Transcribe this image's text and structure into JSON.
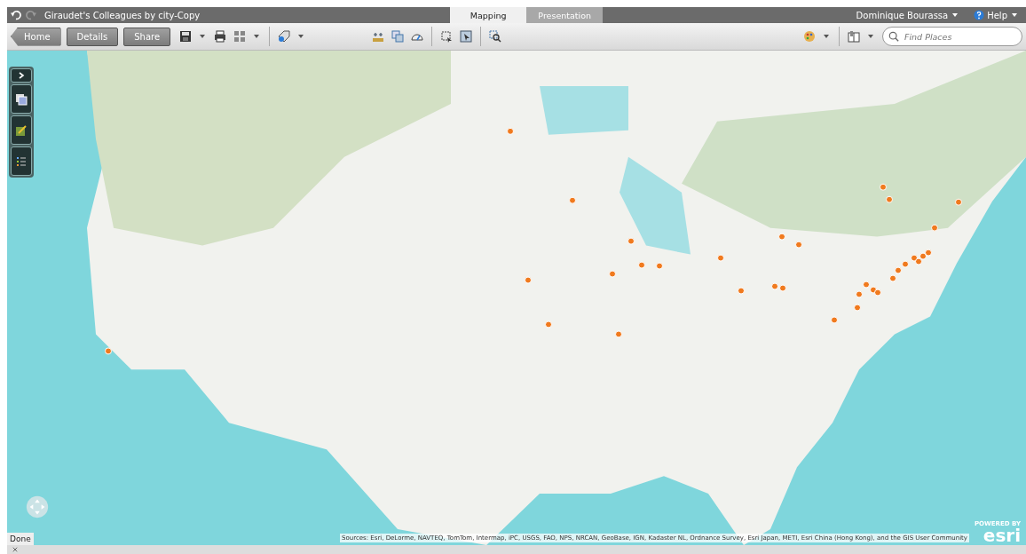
{
  "title_bar": {
    "title": "Giraudet's Colleagues by city-Copy",
    "tabs": [
      {
        "label": "Mapping",
        "selected": true
      },
      {
        "label": "Presentation",
        "selected": false
      }
    ],
    "user": "Dominique Bourassa",
    "help": "Help"
  },
  "toolbar": {
    "buttons": [
      "Home",
      "Details",
      "Share"
    ],
    "search": {
      "placeholder": "Find Places"
    }
  },
  "map": {
    "attribution": "Sources: Esri, DeLorme, NAVTEQ, TomTom, Intermap, iPC, USGS, FAO, NPS, NRCAN, GeoBase, IGN, Kadaster NL, Ordnance Survey, Esri Japan, METI, Esri China (Hong Kong), and the GIS User Community",
    "logo_caption": "POWERED BY",
    "logo": "esri",
    "status": "Done"
  }
}
